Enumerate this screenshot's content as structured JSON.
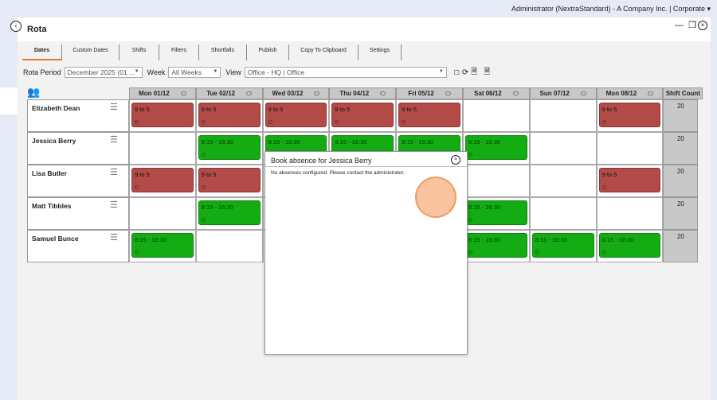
{
  "header": {
    "user_text": "Administrator (NextraStandard) - A Company Inc. | Corporate"
  },
  "window": {
    "title": "Rota",
    "minimize": "—",
    "restore": "❐",
    "close": "×",
    "back": "‹"
  },
  "tabs": [
    "Dates",
    "Custom Dates",
    "Shifts",
    "Filters",
    "Shortfalls",
    "Publish",
    "Copy To Clipboard",
    "Settings"
  ],
  "toolbar": {
    "rota_period_label": "Rota Period",
    "rota_period_value": "December 2025 (01 ...",
    "week_label": "Week",
    "week_value": "All Weeks",
    "view_label": "View",
    "view_value": "Office - HQ | Office"
  },
  "grid": {
    "days": [
      "Mon 01/12",
      "Tue 02/12",
      "Wed 03/12",
      "Thu 04/12",
      "Fri 05/12",
      "Sat 06/12",
      "Sun 07/12",
      "Mon 08/12"
    ],
    "count_header": "Shift Count",
    "rows": [
      {
        "name": "Elizabeth Dean",
        "count": "20",
        "cells": [
          {
            "t": "9 to 5",
            "c": "red"
          },
          {
            "t": "9 to 5",
            "c": "red"
          },
          {
            "t": "9 to 5",
            "c": "red"
          },
          {
            "t": "9 to 5",
            "c": "red"
          },
          {
            "t": "9 to 5",
            "c": "red"
          },
          null,
          null,
          {
            "t": "9 to 5",
            "c": "red"
          }
        ]
      },
      {
        "name": "Jessica Berry",
        "count": "20",
        "cells": [
          null,
          {
            "t": "8:15 - 16:30",
            "c": "green"
          },
          {
            "t": "8:15 - 16:30",
            "c": "green"
          },
          {
            "t": "8:15 - 16:30",
            "c": "green"
          },
          {
            "t": "8:15 - 16:30",
            "c": "green"
          },
          {
            "t": "8:15 - 16:30",
            "c": "green"
          },
          null,
          null
        ]
      },
      {
        "name": "Lisa Butler",
        "count": "20",
        "cells": [
          {
            "t": "9 to 5",
            "c": "red"
          },
          {
            "t": "9 to 5",
            "c": "red"
          },
          null,
          null,
          null,
          null,
          null,
          {
            "t": "9 to 5",
            "c": "red"
          }
        ]
      },
      {
        "name": "Matt Tibbles",
        "count": "20",
        "cells": [
          null,
          {
            "t": "8:15 - 16:30",
            "c": "green"
          },
          null,
          null,
          null,
          {
            "t": "8:15 - 16:30",
            "c": "green"
          },
          null,
          null
        ]
      },
      {
        "name": "Samuel Bunce",
        "count": "20",
        "cells": [
          {
            "t": "8:15 - 16:30",
            "c": "green"
          },
          null,
          null,
          null,
          null,
          {
            "t": "8:15 - 16:30",
            "c": "green"
          },
          {
            "t": "8:15 - 16:30",
            "c": "green"
          },
          {
            "t": "8:15 - 16:30",
            "c": "green"
          }
        ]
      }
    ]
  },
  "modal": {
    "title": "Book absence for Jessica Berry",
    "message": "No absences configured. Please contact the administrator.",
    "close": "×"
  },
  "colors": {
    "accent": "#e07a2c",
    "shift_red": "#b24a48",
    "shift_green": "#13ad13"
  }
}
